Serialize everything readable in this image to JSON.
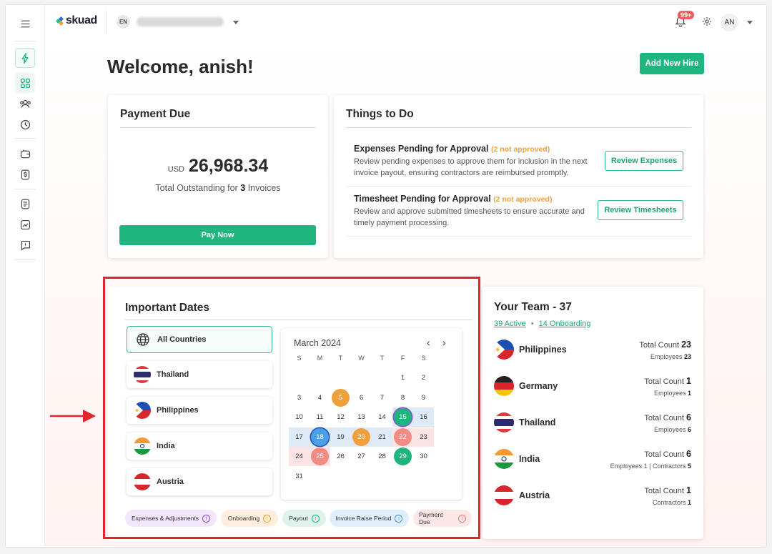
{
  "brand": {
    "name": "skuad",
    "accent": "#1fb57f"
  },
  "topbar": {
    "language": "EN",
    "notification_badge": "99+",
    "avatar_initials": "AN"
  },
  "sidebar": {
    "icons": [
      "menu-icon",
      "bolt-icon",
      "dashboard-icon",
      "people-icon",
      "clock-icon",
      "wallet-icon",
      "dollar-icon",
      "document-icon",
      "analytics-icon",
      "feedback-icon"
    ]
  },
  "header": {
    "welcome": "Welcome, anish!",
    "add_hire": "Add New Hire"
  },
  "payment": {
    "title": "Payment Due",
    "currency": "USD",
    "amount": "26,968.34",
    "outstanding_prefix": "Total Outstanding for",
    "invoice_count": "3",
    "outstanding_suffix": "Invoices",
    "pay_now": "Pay Now"
  },
  "todo": {
    "title": "Things to Do",
    "items": [
      {
        "title": "Expenses Pending for Approval",
        "status": "(2 not approved)",
        "desc": "Review pending expenses to approve them for inclusion in the next invoice payout, ensuring contractors are reimbursed promptly.",
        "button": "Review Expenses"
      },
      {
        "title": "Timesheet Pending for Approval",
        "status": "(2 not approved)",
        "desc": "Review and approve submitted timesheets to ensure accurate and timely payment processing.",
        "button": "Review Timesheets"
      }
    ]
  },
  "dates": {
    "title": "Important Dates",
    "countries": [
      "All Countries",
      "Thailand",
      "Philippines",
      "India",
      "Austria"
    ],
    "month": "March 2024",
    "weekdays": [
      "S",
      "M",
      "T",
      "W",
      "T",
      "F",
      "S"
    ],
    "days": [
      [
        "",
        "",
        "",
        "",
        "",
        "1",
        "2"
      ],
      [
        "3",
        "4",
        "5",
        "6",
        "7",
        "8",
        "9"
      ],
      [
        "10",
        "11",
        "12",
        "13",
        "14",
        "15",
        "16"
      ],
      [
        "17",
        "18",
        "19",
        "20",
        "21",
        "22",
        "23"
      ],
      [
        "24",
        "25",
        "26",
        "27",
        "28",
        "29",
        "30"
      ],
      [
        "31",
        "",
        "",
        "",
        "",
        "",
        ""
      ]
    ],
    "legend": [
      {
        "label": "Expenses & Adjustments",
        "bg": "#f1e6fb",
        "color": "#8a4fd1"
      },
      {
        "label": "Onboarding",
        "bg": "#fdeedd",
        "color": "#f0a03a"
      },
      {
        "label": "Payout",
        "bg": "#dff3ec",
        "color": "#1fb57f"
      },
      {
        "label": "Invoice Raise Period",
        "bg": "#e1eefb",
        "color": "#4a90d9"
      },
      {
        "label": "Payment Due",
        "bg": "#fde7e6",
        "color": "#ef7f78"
      }
    ]
  },
  "team": {
    "title": "Your Team - 37",
    "active": "39 Active",
    "onboarding": "14 Onboarding",
    "separator": "•",
    "rows": [
      {
        "country": "Philippines",
        "total_label": "Total Count",
        "total": "23",
        "sub": "Employees",
        "sub_val": "23"
      },
      {
        "country": "Germany",
        "total_label": "Total Count",
        "total": "1",
        "sub": "Employees",
        "sub_val": "1"
      },
      {
        "country": "Thailand",
        "total_label": "Total Count",
        "total": "6",
        "sub": "Employees",
        "sub_val": "6"
      },
      {
        "country": "India",
        "total_label": "Total Count",
        "total": "6",
        "sub": "Employees 1 | Contractors",
        "sub_val": "5"
      },
      {
        "country": "Austria",
        "total_label": "Total Count",
        "total": "1",
        "sub": "Contractors",
        "sub_val": "1"
      }
    ]
  }
}
